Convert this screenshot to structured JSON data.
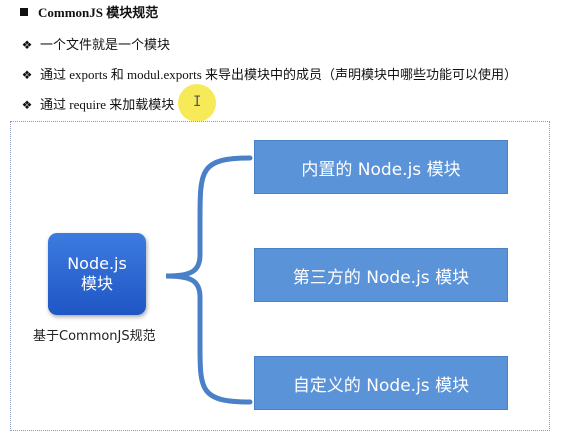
{
  "heading": "CommonJS 模块规范",
  "bullets": [
    "一个文件就是一个模块",
    "通过 exports 和 modul.exports 来导出模块中的成员（声明模块中哪些功能可以使用）",
    "通过 require 来加载模块"
  ],
  "diagram": {
    "center_node": {
      "line1": "Node.js",
      "line2": "模块"
    },
    "center_caption": "基于CommonJS规范",
    "modules": [
      "内置的 Node.js 模块",
      "第三方的 Node.js 模块",
      "自定义的 Node.js 模块"
    ]
  },
  "colors": {
    "center_node": "#2a62d0",
    "module_box": "#5b93d8",
    "brace": "#4a80c8",
    "cursor_highlight": "#f5e63c"
  }
}
